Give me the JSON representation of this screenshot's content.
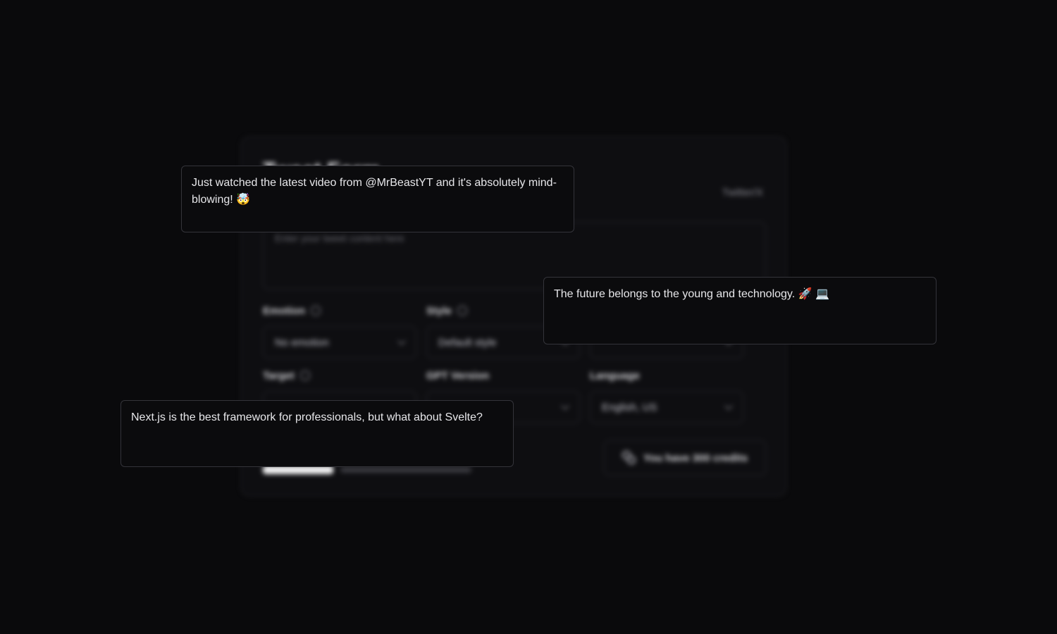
{
  "form": {
    "title": "Tweet Form",
    "subtitle": "Twitter/X",
    "textarea_placeholder": "Enter your tweet content here",
    "fields": [
      {
        "label": "Emotion",
        "value": "No emotion",
        "has_info": true
      },
      {
        "label": "Style",
        "value": "Default style",
        "has_info": true
      },
      {
        "label": "",
        "value": "",
        "has_info": false
      },
      {
        "label": "Target",
        "value": "",
        "has_info": true
      },
      {
        "label": "GPT Version",
        "value": "",
        "has_info": false
      },
      {
        "label": "Language",
        "value": "English, US",
        "has_info": false
      }
    ],
    "credits_text": "You have 300 credits"
  },
  "tweets": [
    {
      "text": "Just watched the latest video from @MrBeastYT and it's absolutely mind-blowing! 🤯"
    },
    {
      "text": "The future belongs to the young and technology. 🚀 💻"
    },
    {
      "text": "Next.js is the best framework for professionals, but what about Svelte?"
    }
  ],
  "icons": {
    "info": "info-circle-icon",
    "chevron": "chevron-down-icon",
    "credits": "coins-icon"
  }
}
